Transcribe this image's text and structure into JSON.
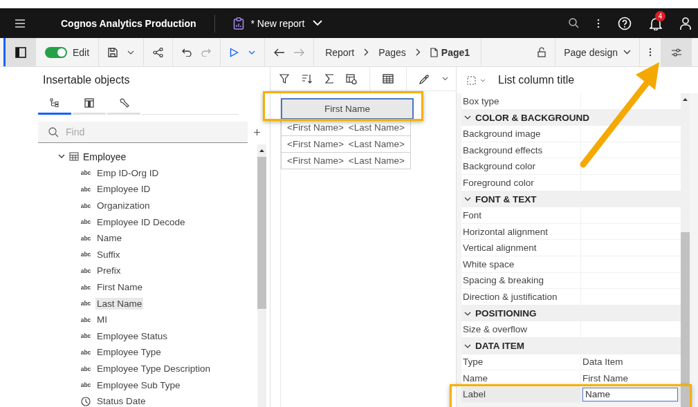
{
  "app_bar": {
    "title": "Cognos Analytics Production",
    "report": "* New report",
    "notifications": "4"
  },
  "toolbar": {
    "edit_on": true,
    "edit_label": "Edit",
    "breadcrumbs": [
      "Report",
      "Pages",
      "Page1"
    ],
    "view": "Page design"
  },
  "insertable_objects": {
    "title": "Insertable objects",
    "tabs": [
      {
        "kind": "source",
        "selected": true
      },
      {
        "kind": "toolbox",
        "selected": false
      },
      {
        "kind": "tools",
        "selected": false
      }
    ],
    "search": {
      "placeholder": "Find"
    },
    "tree": [
      {
        "label": "Employee",
        "kind": "table",
        "expanded": true,
        "children": [
          {
            "label": "Emp ID-Org ID",
            "kind": "text",
            "type_label": "abc",
            "selected": false
          },
          {
            "label": "Employee ID",
            "kind": "text",
            "type_label": "abc",
            "selected": false
          },
          {
            "label": "Organization",
            "kind": "text",
            "type_label": "abc",
            "selected": false
          },
          {
            "label": "Employee ID Decode",
            "kind": "text",
            "type_label": "abc",
            "selected": false
          },
          {
            "label": "Name",
            "kind": "text",
            "type_label": "abc",
            "selected": false
          },
          {
            "label": "Suffix",
            "kind": "text",
            "type_label": "abc",
            "selected": false
          },
          {
            "label": "Prefix",
            "kind": "text",
            "type_label": "abc",
            "selected": false
          },
          {
            "label": "First Name",
            "kind": "text",
            "type_label": "abc",
            "selected": false
          },
          {
            "label": "Last Name",
            "kind": "text",
            "type_label": "abc",
            "selected": true
          },
          {
            "label": "MI",
            "kind": "text",
            "type_label": "abc",
            "selected": false
          },
          {
            "label": "Employee Status",
            "kind": "text",
            "type_label": "abc",
            "selected": false
          },
          {
            "label": "Employee Type",
            "kind": "text",
            "type_label": "abc",
            "selected": false
          },
          {
            "label": "Employee Type Description",
            "kind": "text",
            "type_label": "abc",
            "selected": false
          },
          {
            "label": "Employee Sub Type",
            "kind": "text",
            "type_label": "abc",
            "selected": false
          },
          {
            "label": "Status Date",
            "kind": "date",
            "selected": false
          }
        ]
      }
    ]
  },
  "list": {
    "header": {
      "label": "First Name",
      "selected": true
    },
    "rows": [
      [
        "<First Name>",
        "<Last Name>"
      ],
      [
        "<First Name>",
        "<Last Name>"
      ],
      [
        "<First Name>",
        "<Last Name>"
      ]
    ]
  },
  "properties": {
    "title": "List column title",
    "items": [
      {
        "kind": "property",
        "label": "Box type"
      },
      {
        "kind": "section",
        "label": "COLOR & BACKGROUND",
        "expanded": true
      },
      {
        "kind": "property",
        "label": "Background image"
      },
      {
        "kind": "property",
        "label": "Background effects"
      },
      {
        "kind": "property",
        "label": "Background color"
      },
      {
        "kind": "property",
        "label": "Foreground color"
      },
      {
        "kind": "section",
        "label": "FONT & TEXT",
        "expanded": true
      },
      {
        "kind": "property",
        "label": "Font"
      },
      {
        "kind": "property",
        "label": "Horizontal alignment"
      },
      {
        "kind": "property",
        "label": "Vertical alignment"
      },
      {
        "kind": "property",
        "label": "White space"
      },
      {
        "kind": "property",
        "label": "Spacing & breaking"
      },
      {
        "kind": "property",
        "label": "Direction & justification"
      },
      {
        "kind": "section",
        "label": "POSITIONING",
        "expanded": true
      },
      {
        "kind": "property",
        "label": "Size & overflow"
      },
      {
        "kind": "section",
        "label": "DATA ITEM",
        "expanded": true
      },
      {
        "kind": "property",
        "label": "Type",
        "value": "Data Item"
      },
      {
        "kind": "property",
        "label": "Name",
        "value": "First Name"
      },
      {
        "kind": "input",
        "label": "Label",
        "value": "Name",
        "selected": true
      }
    ]
  }
}
